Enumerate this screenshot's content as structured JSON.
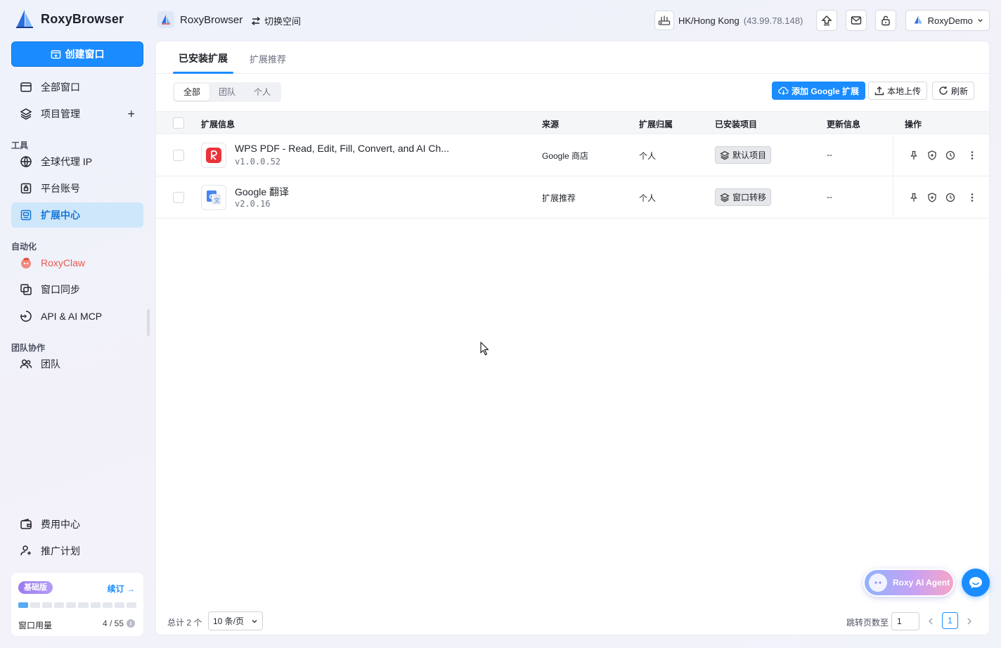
{
  "brand": {
    "name": "RoxyBrowser"
  },
  "sidebar": {
    "create_label": "创建窗口",
    "items": {
      "all_windows": "全部窗口",
      "projects": "项目管理",
      "proxy": "全球代理 IP",
      "accounts": "平台账号",
      "extensions": "扩展中心",
      "claw": "RoxyClaw",
      "sync": "窗口同步",
      "api": "API & AI MCP",
      "team": "团队",
      "billing": "费用中心",
      "referral": "推广计划"
    },
    "sections": {
      "tools": "工具",
      "automation": "自动化",
      "collab": "团队协作"
    },
    "plan": {
      "badge": "基础版",
      "renew": "续订",
      "usage_label": "窗口用量",
      "usage_value": "4 / 55",
      "usage_fraction": 0.073
    }
  },
  "topbar": {
    "workspace": "RoxyBrowser",
    "switch_space": "切换空间",
    "proxy_location": "HK/Hong Kong",
    "proxy_ip": "(43.99.78.148)",
    "user": "RoxyDemo"
  },
  "main": {
    "tabs": [
      "已安装扩展",
      "扩展推荐"
    ],
    "filters": [
      "全部",
      "团队",
      "个人"
    ],
    "actions": {
      "add_google": "添加 Google 扩展",
      "upload": "本地上传",
      "refresh": "刷新"
    },
    "columns": {
      "info": "扩展信息",
      "source": "来源",
      "owner": "扩展归属",
      "installed": "已安装项目",
      "update": "更新信息",
      "ops": "操作"
    },
    "rows": [
      {
        "name": "WPS PDF - Read, Edit, Fill, Convert, and AI Ch...",
        "version": "v1.0.0.52",
        "source": "Google 商店",
        "owner": "个人",
        "installed": "默认项目",
        "update": "--"
      },
      {
        "name": "Google 翻译",
        "version": "v2.0.16",
        "source": "扩展推荐",
        "owner": "个人",
        "installed": "窗口转移",
        "update": "--"
      }
    ],
    "footer": {
      "total": "总计 2 个",
      "page_size": "10 条/页",
      "jump_label": "跳转页数至",
      "jump_value": "1",
      "current_page": "1"
    }
  },
  "floating": {
    "agent": "Roxy AI Agent"
  },
  "colors": {
    "accent": "#1a8cff",
    "active_nav_bg": "#cfe7fb",
    "claw": "#e8594f"
  }
}
